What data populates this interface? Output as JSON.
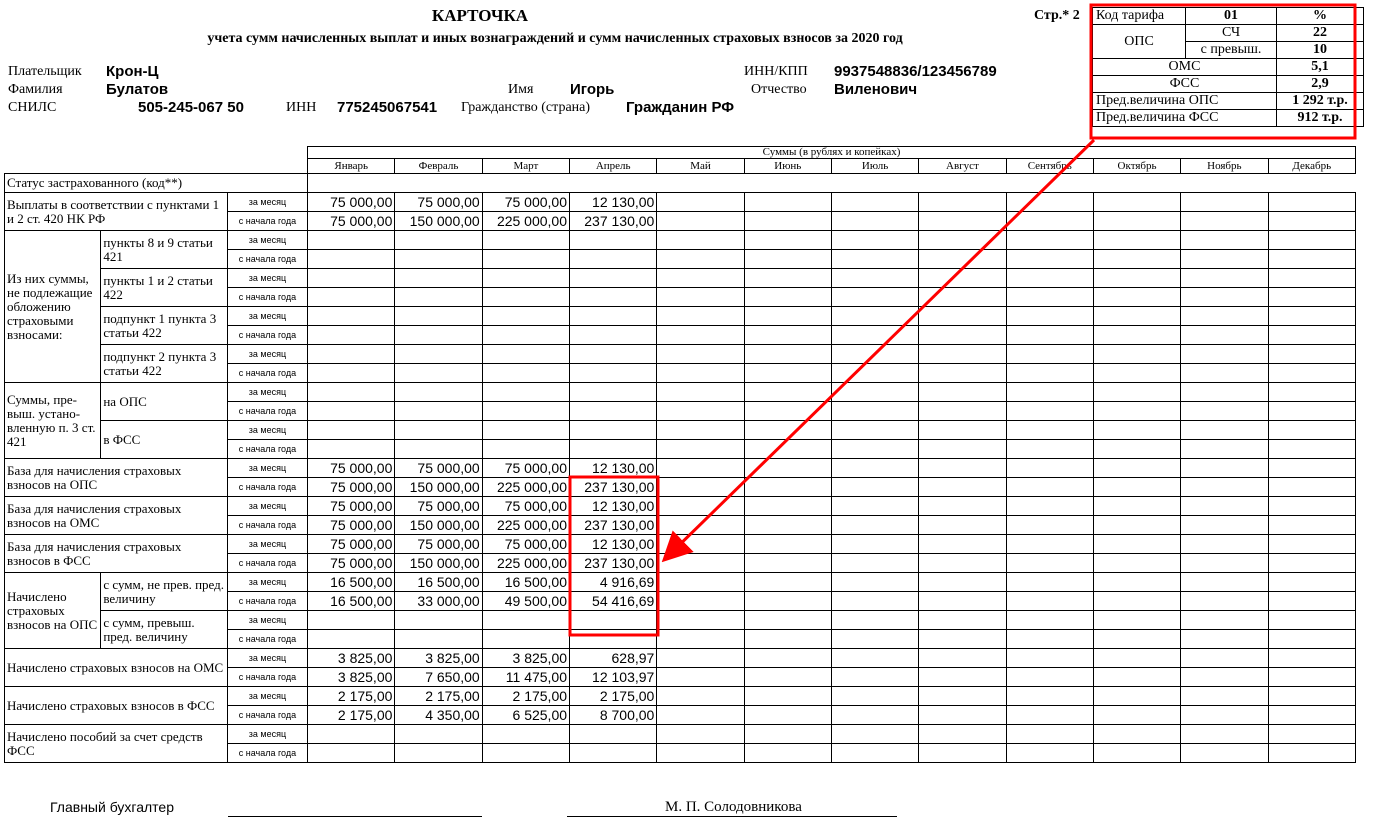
{
  "header": {
    "title": "КАРТОЧКА",
    "subtitle": "учета сумм начисленных выплат и иных вознаграждений и сумм начисленных страховых взносов за 2020 год",
    "page": "Стр.* 2"
  },
  "payer": {
    "payer_label": "Плательщик",
    "payer_value": "Крон-Ц",
    "inn_kpp_label": "ИНН/КПП",
    "inn_kpp_value": "9937548836/123456789",
    "surname_label": "Фамилия",
    "surname_value": "Булатов",
    "name_label": "Имя",
    "name_value": "Игорь",
    "patronymic_label": "Отчество",
    "patronymic_value": "Виленович",
    "snils_label": "СНИЛС",
    "snils_value": "505-245-067 50",
    "inn_label": "ИНН",
    "inn_value": "775245067541",
    "citizenship_label": "Гражданство (страна)",
    "citizenship_value": "Гражданин РФ"
  },
  "tariff": {
    "code_label": "Код тарифа",
    "code_value": "01",
    "percent_label": "%",
    "ops_label": "ОПС",
    "sch_label": "СЧ",
    "sch_value": "22",
    "over_label": "с превыш.",
    "over_value": "10",
    "oms_label": "ОМС",
    "oms_value": "5,1",
    "fss_label": "ФСС",
    "fss_value": "2,9",
    "limit_ops_label": "Пред.величина ОПС",
    "limit_ops_value": "1 292 т.р.",
    "limit_fss_label": "Пред.величина ФСС",
    "limit_fss_value": "912 т.р."
  },
  "table": {
    "sums_header": "Суммы (в рублях и копейках)",
    "months": [
      "Январь",
      "Февраль",
      "Март",
      "Апрель",
      "Май",
      "Июнь",
      "Июль",
      "Август",
      "Сентябрь",
      "Октябрь",
      "Ноябрь",
      "Декабрь"
    ],
    "status_label": "Статус застрахованного (код**)",
    "per_month": "за месяц",
    "per_year": "с начала года",
    "payments_label": "Выплаты в соответствии с пунктами 1 и 2 ст. 420 НК РФ",
    "of_them_label": "Из них суммы, не подлежащие обложению страховыми взносами:",
    "sub_8_9": "пункты 8 и 9 статьи 421",
    "sub_1_2": "пункты 1 и 2 статьи 422",
    "sub_p1_3": "подпункт 1 пункта 3 статьи 422",
    "sub_p2_3": "подпункт 2 пункта 3 статьи 422",
    "excess_label": "Суммы, пре-выш. устано-вленную п. 3 ст. 421",
    "excess_ops": "на ОПС",
    "excess_fss": "в ФСС",
    "base_ops_label": "База для начисления страховых взносов на ОПС",
    "base_oms_label": "База для начисления страховых взносов на ОМС",
    "base_fss_label": "База для начисления страховых взносов в ФСС",
    "accrued_ops_label": "Начислено страховых взносов на ОПС",
    "not_over_label": "с сумм, не прев. пред. величину",
    "over_label": "с сумм, превыш. пред. величину",
    "accrued_oms_label": "Начислено страховых взносов на ОМС",
    "accrued_fss_label": "Начислено страховых взносов в ФСС",
    "benefits_label": "Начислено пособий за счет средств ФСС",
    "payments_month": [
      "75 000,00",
      "75 000,00",
      "75 000,00",
      "12 130,00"
    ],
    "payments_year": [
      "75 000,00",
      "150 000,00",
      "225 000,00",
      "237 130,00"
    ],
    "base_ops_month": [
      "75 000,00",
      "75 000,00",
      "75 000,00",
      "12 130,00"
    ],
    "base_ops_year": [
      "75 000,00",
      "150 000,00",
      "225 000,00",
      "237 130,00"
    ],
    "base_oms_month": [
      "75 000,00",
      "75 000,00",
      "75 000,00",
      "12 130,00"
    ],
    "base_oms_year": [
      "75 000,00",
      "150 000,00",
      "225 000,00",
      "237 130,00"
    ],
    "base_fss_month": [
      "75 000,00",
      "75 000,00",
      "75 000,00",
      "12 130,00"
    ],
    "base_fss_year": [
      "75 000,00",
      "150 000,00",
      "225 000,00",
      "237 130,00"
    ],
    "ops_not_over_month": [
      "16 500,00",
      "16 500,00",
      "16 500,00",
      "4 916,69"
    ],
    "ops_not_over_year": [
      "16 500,00",
      "33 000,00",
      "49 500,00",
      "54 416,69"
    ],
    "oms_month": [
      "3 825,00",
      "3 825,00",
      "3 825,00",
      "628,97"
    ],
    "oms_year": [
      "3 825,00",
      "7 650,00",
      "11 475,00",
      "12 103,97"
    ],
    "fss_month": [
      "2 175,00",
      "2 175,00",
      "2 175,00",
      "2 175,00"
    ],
    "fss_year": [
      "2 175,00",
      "4 350,00",
      "6 525,00",
      "8 700,00"
    ]
  },
  "signature": {
    "role": "Главный бухгалтер",
    "name": "М. П. Солодовникова"
  },
  "annotation": {
    "color": "#ff0000"
  }
}
